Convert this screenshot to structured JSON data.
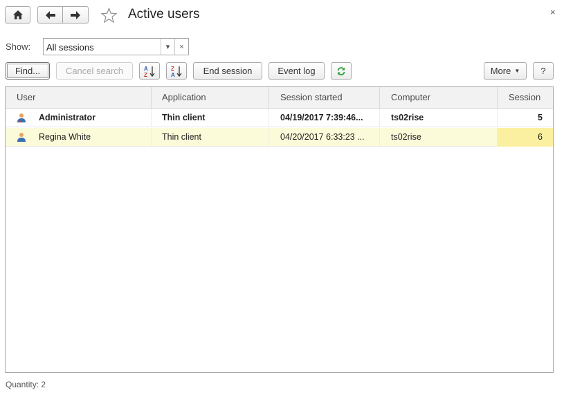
{
  "window": {
    "title": "Active users",
    "close_symbol": "×"
  },
  "nav": {
    "home_icon": "home-icon",
    "back_icon": "arrow-left-icon",
    "forward_icon": "arrow-right-icon",
    "favorite_icon": "star-icon"
  },
  "filter": {
    "label": "Show:",
    "value": "All sessions",
    "dropdown_symbol": "▾",
    "clear_symbol": "×"
  },
  "toolbar": {
    "find": "Find...",
    "cancel_search": "Cancel search",
    "end_session": "End session",
    "event_log": "Event log",
    "more": "More",
    "help": "?"
  },
  "table": {
    "columns": [
      "User",
      "Application",
      "Session started",
      "Computer",
      "Session"
    ],
    "rows": [
      {
        "user": "Administrator",
        "application": "Thin client",
        "started": "04/19/2017 7:39:46...",
        "computer": "ts02rise",
        "session": "5"
      },
      {
        "user": "Regina White",
        "application": "Thin client",
        "started": "04/20/2017 6:33:23 ...",
        "computer": "ts02rise",
        "session": "6"
      }
    ]
  },
  "footer": {
    "quantity": "Quantity: 2"
  },
  "colors": {
    "selected_row": "#fbfbd9",
    "active_cell": "#fbf0a0",
    "refresh_icon": "#2e9e3a"
  }
}
